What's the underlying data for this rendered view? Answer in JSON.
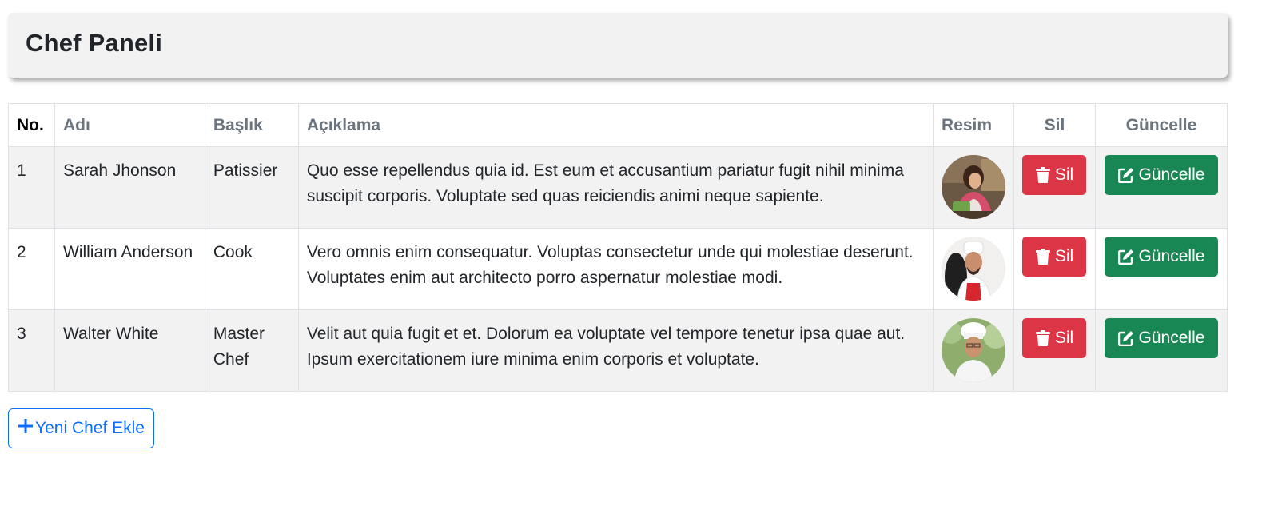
{
  "header": {
    "title": "Chef Paneli"
  },
  "table": {
    "columns": {
      "no": "No.",
      "name": "Adı",
      "title": "Başlık",
      "description": "Açıklama",
      "image": "Resim",
      "delete": "Sil",
      "update": "Güncelle"
    },
    "rows": [
      {
        "no": "1",
        "name": "Sarah Jhonson",
        "title": "Patissier",
        "description": "Quo esse repellendus quia id. Est eum et accusantium pariatur fugit nihil minima suscipit corporis. Voluptate sed quas reiciendis animi neque sapiente.",
        "avatar_icon": "chef-photo",
        "delete_label": "Sil",
        "update_label": "Güncelle"
      },
      {
        "no": "2",
        "name": "William Anderson",
        "title": "Cook",
        "description": "Vero omnis enim consequatur. Voluptas consectetur unde qui molestiae deserunt. Voluptates enim aut architecto porro aspernatur molestiae modi.",
        "avatar_icon": "chef-photo",
        "delete_label": "Sil",
        "update_label": "Güncelle"
      },
      {
        "no": "3",
        "name": "Walter White",
        "title": "Master Chef",
        "description": "Velit aut quia fugit et et. Dolorum ea voluptate vel tempore tenetur ipsa quae aut. Ipsum exercitationem iure minima enim corporis et voluptate.",
        "avatar_icon": "chef-photo",
        "delete_label": "Sil",
        "update_label": "Güncelle"
      }
    ]
  },
  "add_button": {
    "label": "Yeni Chef Ekle",
    "icon": "plus-icon"
  },
  "colors": {
    "danger": "#dc3545",
    "success": "#198754",
    "primary": "#0d6efd",
    "header_bg": "#f2f2f2"
  }
}
